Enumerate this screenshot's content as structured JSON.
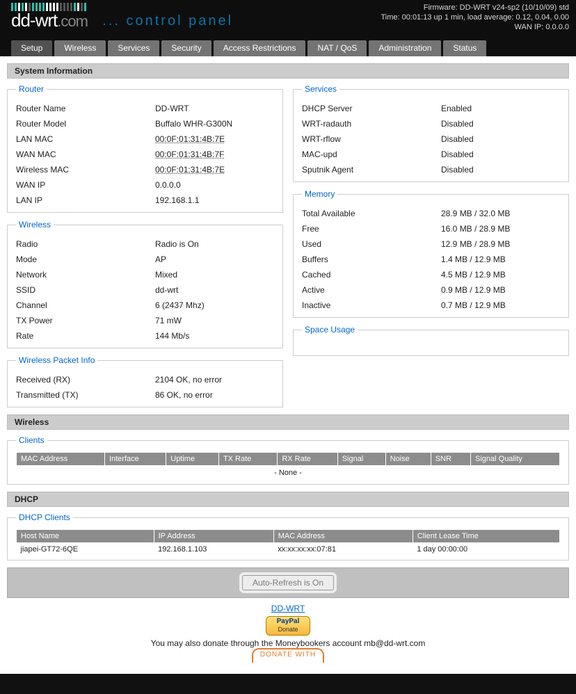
{
  "header": {
    "firmware": "Firmware: DD-WRT v24-sp2 (10/10/09) std",
    "uptime": "Time: 00:01:13 up 1 min, load average: 0.12, 0.04, 0.00",
    "wanip": "WAN IP: 0.0.0.0",
    "cp_label": "... control panel"
  },
  "menu": [
    "Setup",
    "Wireless",
    "Services",
    "Security",
    "Access Restrictions",
    "NAT / QoS",
    "Administration",
    "Status"
  ],
  "sections": {
    "sysinfo": "System Information",
    "wireless": "Wireless",
    "dhcp": "DHCP"
  },
  "router": {
    "legend": "Router",
    "rows": [
      {
        "k": "Router Name",
        "v": "DD-WRT"
      },
      {
        "k": "Router Model",
        "v": "Buffalo WHR-G300N"
      },
      {
        "k": "LAN MAC",
        "v": "00:0F:01:31:4B:7E",
        "mac": true
      },
      {
        "k": "WAN MAC",
        "v": "00:0F:01:31:4B:7F",
        "mac": true
      },
      {
        "k": "Wireless MAC",
        "v": "00:0F:01:31:4B:7E",
        "mac": true
      },
      {
        "k": "WAN IP",
        "v": "0.0.0.0"
      },
      {
        "k": "LAN IP",
        "v": "192.168.1.1"
      }
    ]
  },
  "wireless_box": {
    "legend": "Wireless",
    "rows": [
      {
        "k": "Radio",
        "v": "Radio is On"
      },
      {
        "k": "Mode",
        "v": "AP"
      },
      {
        "k": "Network",
        "v": "Mixed"
      },
      {
        "k": "SSID",
        "v": "dd-wrt"
      },
      {
        "k": "Channel",
        "v": "6 (2437 Mhz)"
      },
      {
        "k": "TX Power",
        "v": "71 mW"
      },
      {
        "k": "Rate",
        "v": "144 Mb/s"
      }
    ]
  },
  "pktinfo": {
    "legend": "Wireless Packet Info",
    "rows": [
      {
        "k": "Received (RX)",
        "v": "2104 OK, no error"
      },
      {
        "k": "Transmitted (TX)",
        "v": "86 OK, no error"
      }
    ]
  },
  "services": {
    "legend": "Services",
    "rows": [
      {
        "k": "DHCP Server",
        "v": "Enabled"
      },
      {
        "k": "WRT-radauth",
        "v": "Disabled"
      },
      {
        "k": "WRT-rflow",
        "v": "Disabled"
      },
      {
        "k": "MAC-upd",
        "v": "Disabled"
      },
      {
        "k": "Sputnik Agent",
        "v": "Disabled"
      }
    ]
  },
  "memory": {
    "legend": "Memory",
    "rows": [
      {
        "k": "Total Available",
        "v": "28.9 MB / 32.0 MB"
      },
      {
        "k": "Free",
        "v": "16.0 MB / 28.9 MB"
      },
      {
        "k": "Used",
        "v": "12.9 MB / 28.9 MB"
      },
      {
        "k": "Buffers",
        "v": "1.4 MB / 12.9 MB"
      },
      {
        "k": "Cached",
        "v": "4.5 MB / 12.9 MB"
      },
      {
        "k": "Active",
        "v": "0.9 MB / 12.9 MB"
      },
      {
        "k": "Inactive",
        "v": "0.7 MB / 12.9 MB"
      }
    ]
  },
  "space": {
    "legend": "Space Usage"
  },
  "clients": {
    "legend": "Clients",
    "cols": [
      "MAC Address",
      "Interface",
      "Uptime",
      "TX Rate",
      "RX Rate",
      "Signal",
      "Noise",
      "SNR",
      "Signal Quality"
    ],
    "none": "- None -"
  },
  "dhcp_clients": {
    "legend": "DHCP Clients",
    "cols": [
      "Host Name",
      "IP Address",
      "MAC Address",
      "Client Lease Time"
    ],
    "rows": [
      {
        "host": "jiapei-GT72-6QE",
        "ip": "192.168.1.103",
        "mac": "xx:xx:xx:xx:07:81",
        "lease": "1 day 00:00:00"
      }
    ]
  },
  "footer": {
    "autorefresh": "Auto-Refresh is On",
    "link": "DD-WRT",
    "donate_text": "You may also donate through the Moneybookers account mb@dd-wrt.com",
    "donate_with": "DONATE WITH"
  }
}
